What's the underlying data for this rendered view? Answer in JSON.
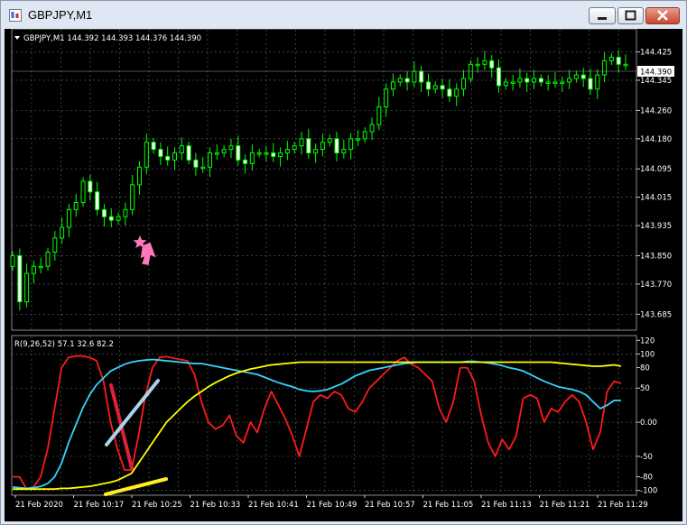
{
  "window": {
    "title": "GBPJPY,M1",
    "controls": [
      "minimize",
      "maximize",
      "close"
    ],
    "icons": {
      "app": "chart-app-icon",
      "min": "minimize-icon",
      "max": "maximize-icon",
      "close": "close-icon"
    },
    "colors": {
      "titlebar": "#dfe7f3",
      "close_button": "#c9452c"
    }
  },
  "price_panel": {
    "header": "GBPJPY,M1  144.392 144.393 144.376 144.390",
    "current_price_label": "144.390",
    "price_ticks": [
      "144.425",
      "144.345",
      "144.260",
      "144.180",
      "144.095",
      "144.015",
      "143.935",
      "143.850",
      "143.770",
      "143.685"
    ],
    "colors": {
      "background": "#000000",
      "bull_candle": "#00ff00",
      "bear_candle": "#ffffff",
      "grid": "#5a6a6a"
    },
    "annotations": [
      {
        "icon": "star-icon",
        "color": "#ff77bb"
      },
      {
        "icon": "up-arrow-icon",
        "color": "#ff77bb"
      }
    ]
  },
  "indicator_panel": {
    "header": "R(9,26,52) 57.1 32.6 82.2",
    "scale_ticks": [
      "120",
      "100",
      "80",
      "50",
      "0.00",
      "-50",
      "-80",
      "-100"
    ],
    "colors": {
      "fast": "#ff1a1a",
      "mid": "#33d6ff",
      "slow": "#ffff00",
      "mark_red": "#e0203a",
      "mark_blue": "#a9d3ea",
      "mark_yellow": "#ffee22"
    }
  },
  "time_axis": [
    "21 Feb 2020",
    "21 Feb 10:17",
    "21 Feb 10:25",
    "21 Feb 10:33",
    "21 Feb 10:41",
    "21 Feb 10:49",
    "21 Feb 10:57",
    "21 Feb 11:05",
    "21 Feb 11:13",
    "21 Feb 11:21",
    "21 Feb 11:29"
  ],
  "chart_data": [
    {
      "type": "candlestick",
      "title": "GBPJPY,M1",
      "ylim": [
        143.685,
        144.425
      ],
      "closes": [
        143.85,
        143.72,
        143.8,
        143.82,
        143.82,
        143.86,
        143.9,
        143.93,
        143.98,
        144.0,
        144.06,
        144.03,
        143.98,
        143.96,
        143.95,
        143.96,
        143.98,
        144.05,
        144.1,
        144.17,
        144.15,
        144.13,
        144.12,
        144.14,
        144.16,
        144.12,
        144.1,
        144.1,
        144.14,
        144.14,
        144.15,
        144.16,
        144.12,
        144.11,
        144.14,
        144.14,
        144.14,
        144.13,
        144.14,
        144.15,
        144.16,
        144.18,
        144.14,
        144.15,
        144.17,
        144.18,
        144.14,
        144.15,
        144.18,
        144.18,
        144.2,
        144.22,
        144.27,
        144.32,
        144.34,
        144.35,
        144.34,
        144.37,
        144.34,
        144.32,
        144.33,
        144.32,
        144.3,
        144.32,
        144.35,
        144.39,
        144.39,
        144.4,
        144.38,
        144.33,
        144.34,
        144.34,
        144.35,
        144.34,
        144.35,
        144.34,
        144.34,
        144.34,
        144.34,
        144.35,
        144.36,
        144.35,
        144.32,
        144.36,
        144.4,
        144.41,
        144.39,
        144.39
      ]
    },
    {
      "type": "line",
      "title": "R(9,26,52)",
      "ylim": [
        -100,
        120
      ],
      "series": [
        {
          "name": "",
          "values": [
            -80,
            -80,
            -98,
            -95,
            -80,
            -40,
            20,
            80,
            95,
            97,
            97,
            95,
            90,
            60,
            0,
            -40,
            -70,
            -70,
            -20,
            40,
            80,
            95,
            96,
            94,
            92,
            90,
            70,
            30,
            0,
            -10,
            -5,
            10,
            -20,
            -30,
            0,
            -15,
            20,
            45,
            25,
            5,
            -20,
            -50,
            -10,
            30,
            40,
            35,
            45,
            40,
            20,
            15,
            30,
            50,
            60,
            70,
            80,
            90,
            95,
            85,
            80,
            70,
            60,
            20,
            0,
            30,
            80,
            80,
            60,
            10,
            -30,
            -50,
            -25,
            -40,
            -20,
            35,
            40,
            35,
            0,
            20,
            15,
            30,
            40,
            30,
            0,
            -40,
            -15,
            45,
            60,
            57
          ]
        },
        {
          "name": "",
          "values": [
            -95,
            -96,
            -97,
            -96,
            -94,
            -90,
            -80,
            -60,
            -30,
            -5,
            20,
            40,
            55,
            65,
            75,
            80,
            85,
            88,
            90,
            91,
            92,
            91,
            90,
            89,
            88,
            87,
            86,
            86,
            84,
            82,
            80,
            78,
            76,
            74,
            72,
            70,
            66,
            62,
            58,
            55,
            52,
            48,
            46,
            45,
            46,
            48,
            52,
            56,
            62,
            68,
            72,
            76,
            78,
            80,
            82,
            84,
            86,
            87,
            88,
            88,
            88,
            88,
            88,
            88,
            88,
            89,
            89,
            88,
            87,
            85,
            83,
            80,
            78,
            75,
            70,
            65,
            60,
            56,
            52,
            50,
            48,
            45,
            40,
            30,
            20,
            25,
            32,
            32
          ]
        },
        {
          "name": "",
          "values": [
            -98,
            -98,
            -98,
            -98,
            -98,
            -98,
            -98,
            -97,
            -97,
            -96,
            -95,
            -94,
            -92,
            -90,
            -88,
            -85,
            -80,
            -75,
            -60,
            -45,
            -30,
            -15,
            0,
            10,
            20,
            30,
            38,
            45,
            52,
            58,
            63,
            68,
            72,
            75,
            78,
            80,
            82,
            84,
            85,
            86,
            87,
            88,
            88,
            88,
            88,
            88,
            88,
            88,
            88,
            88,
            88,
            88,
            88,
            88,
            88,
            88,
            88,
            88,
            88,
            88,
            88,
            88,
            88,
            88,
            88,
            88,
            88,
            88,
            88,
            88,
            88,
            88,
            88,
            88,
            88,
            88,
            88,
            88,
            87,
            86,
            85,
            84,
            83,
            82,
            82,
            83,
            84,
            82
          ]
        }
      ]
    }
  ]
}
